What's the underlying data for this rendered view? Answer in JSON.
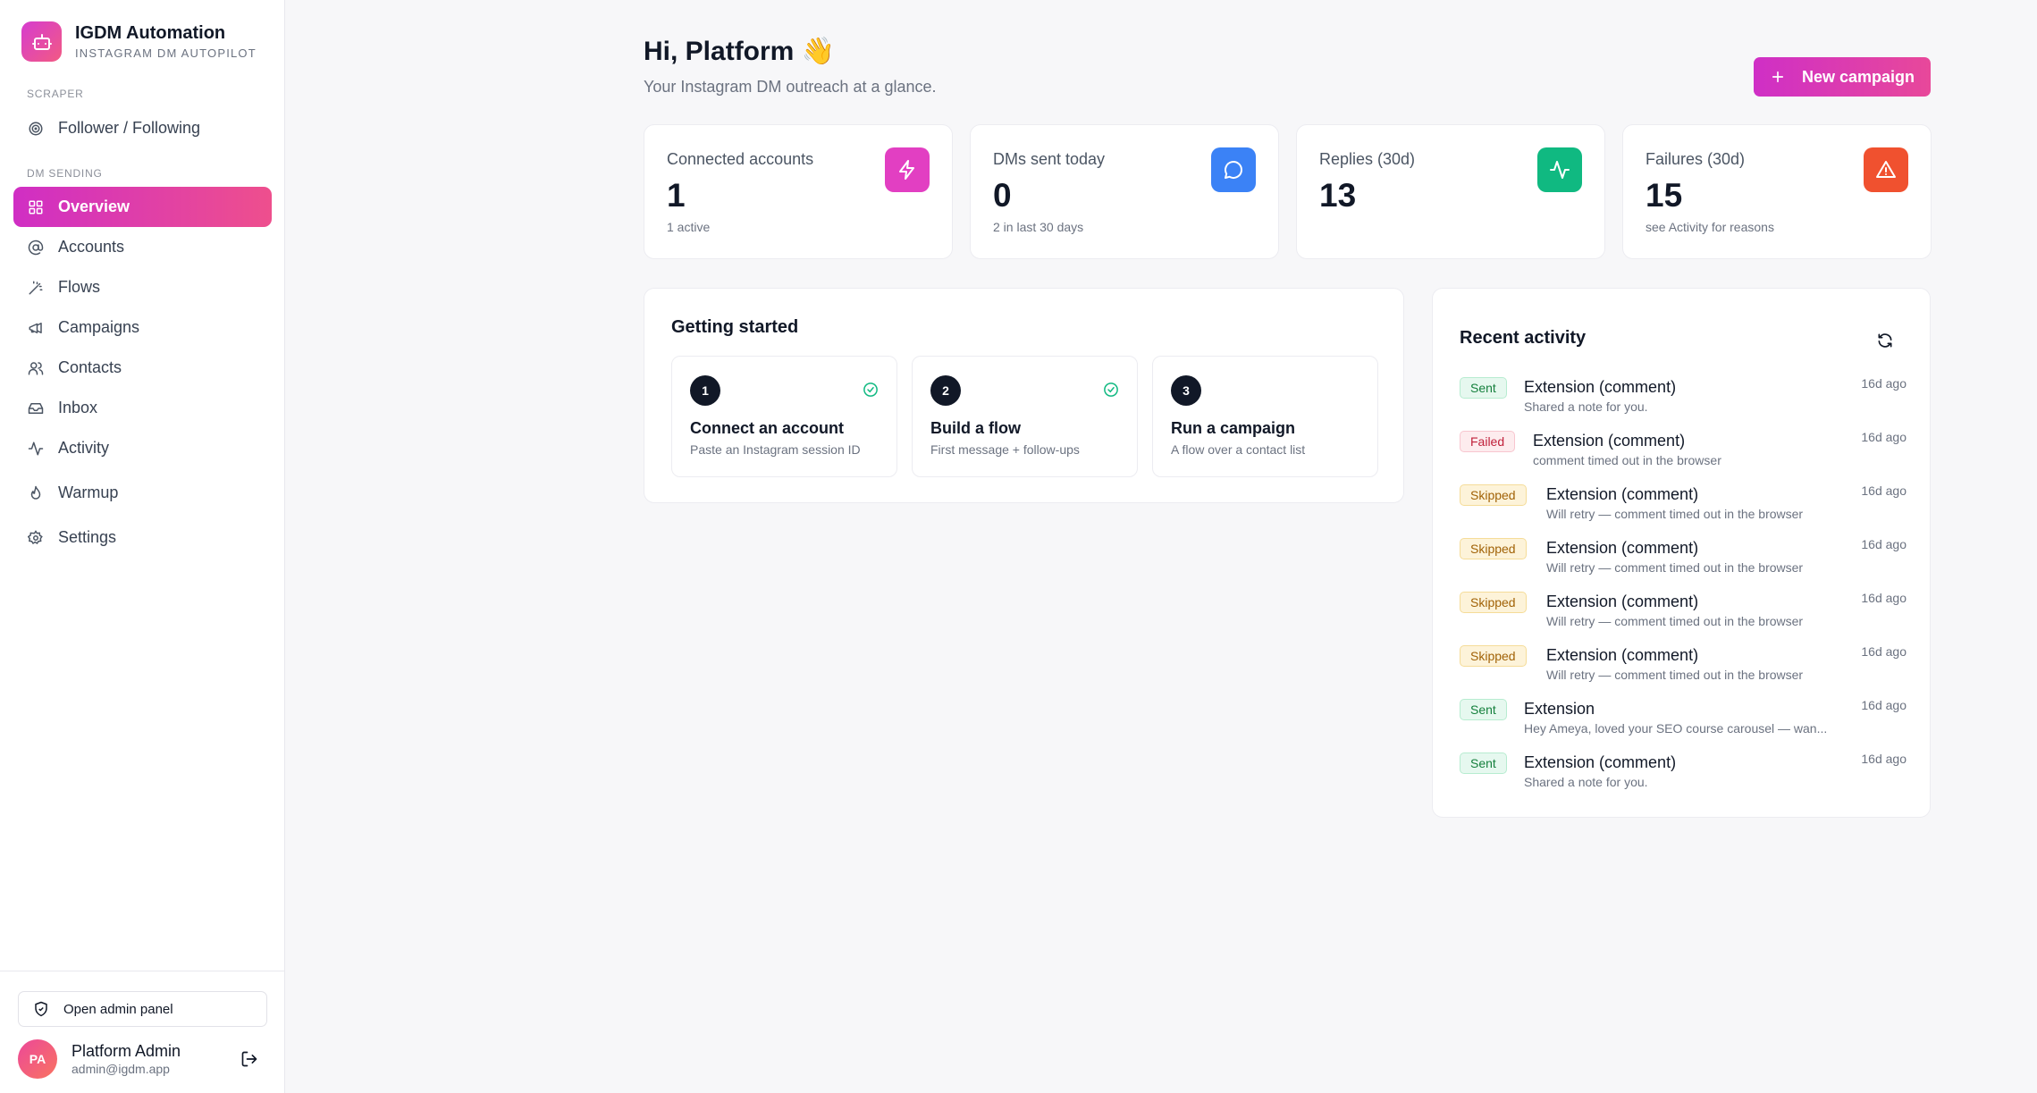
{
  "brand": {
    "title": "IGDM Automation",
    "subtitle": "INSTAGRAM DM AUTOPILOT"
  },
  "sidebar": {
    "section_scraper": "SCRAPER",
    "section_dm": "DM SENDING",
    "items": [
      {
        "label": "Follower / Following",
        "icon": "target-icon"
      },
      {
        "label": "Overview",
        "icon": "grid-icon",
        "active": true
      },
      {
        "label": "Accounts",
        "icon": "at-icon"
      },
      {
        "label": "Flows",
        "icon": "wand-icon"
      },
      {
        "label": "Campaigns",
        "icon": "megaphone-icon"
      },
      {
        "label": "Contacts",
        "icon": "users-icon"
      },
      {
        "label": "Inbox",
        "icon": "inbox-icon"
      },
      {
        "label": "Activity",
        "icon": "activity-icon"
      },
      {
        "label": "Warmup",
        "icon": "flame-icon"
      },
      {
        "label": "Settings",
        "icon": "gear-icon"
      }
    ],
    "admin_button": "Open admin panel",
    "user": {
      "initials": "PA",
      "name": "Platform Admin",
      "email": "admin@igdm.app"
    }
  },
  "header": {
    "greeting": "Hi, Platform 👋",
    "subtitle": "Your Instagram DM outreach at a glance.",
    "new_campaign": "New campaign"
  },
  "stats": [
    {
      "label": "Connected accounts",
      "value": "1",
      "foot": "1 active",
      "icon": "zap-icon",
      "color": "#e23fc2"
    },
    {
      "label": "DMs sent today",
      "value": "0",
      "foot": "2 in last 30 days",
      "icon": "message-icon",
      "color": "#3b82f6"
    },
    {
      "label": "Replies (30d)",
      "value": "13",
      "foot": "",
      "icon": "activity-icon",
      "color": "#10b981"
    },
    {
      "label": "Failures (30d)",
      "value": "15",
      "foot": "see Activity for reasons",
      "icon": "alert-icon",
      "color": "#f0512f"
    }
  ],
  "getting_started": {
    "title": "Getting started",
    "steps": [
      {
        "num": "1",
        "title": "Connect an account",
        "desc": "Paste an Instagram session ID",
        "done": true
      },
      {
        "num": "2",
        "title": "Build a flow",
        "desc": "First message + follow-ups",
        "done": true
      },
      {
        "num": "3",
        "title": "Run a campaign",
        "desc": "A flow over a contact list",
        "done": false
      }
    ]
  },
  "recent_activity": {
    "title": "Recent activity",
    "items": [
      {
        "status": "Sent",
        "title": "Extension (comment)",
        "desc": "Shared a note for you.",
        "time": "16d ago"
      },
      {
        "status": "Failed",
        "title": "Extension (comment)",
        "desc": "comment timed out in the browser",
        "time": "16d ago"
      },
      {
        "status": "Skipped",
        "title": "Extension (comment)",
        "desc": "Will retry — comment timed out in the browser",
        "time": "16d ago"
      },
      {
        "status": "Skipped",
        "title": "Extension (comment)",
        "desc": "Will retry — comment timed out in the browser",
        "time": "16d ago"
      },
      {
        "status": "Skipped",
        "title": "Extension (comment)",
        "desc": "Will retry — comment timed out in the browser",
        "time": "16d ago"
      },
      {
        "status": "Skipped",
        "title": "Extension (comment)",
        "desc": "Will retry — comment timed out in the browser",
        "time": "16d ago"
      },
      {
        "status": "Sent",
        "title": "Extension",
        "desc": "Hey Ameya, loved your SEO course carousel — wan...",
        "time": "16d ago"
      },
      {
        "status": "Sent",
        "title": "Extension (comment)",
        "desc": "Shared a note for you.",
        "time": "16d ago"
      }
    ]
  }
}
